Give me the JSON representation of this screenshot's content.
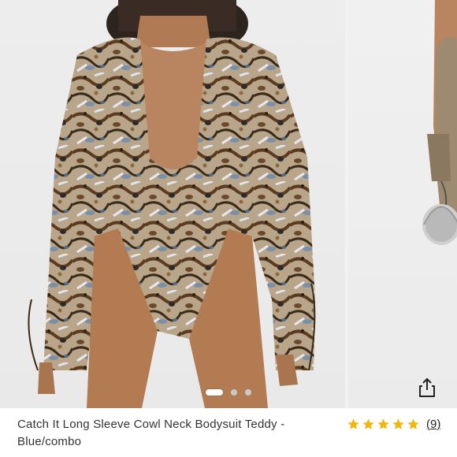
{
  "product": {
    "title": "Catch It Long Sleeve Cowl Neck Bodysuit Teddy - Blue/combo",
    "rating_stars": 5,
    "rating_count": "(9)"
  },
  "gallery": {
    "current_index": 1,
    "total_images": 3,
    "main_image_icon": "product-photo",
    "share_icon": "share-icon"
  },
  "colors": {
    "star": "#f2b705",
    "background": "#ffffff",
    "photo_bg": "#ececec"
  }
}
